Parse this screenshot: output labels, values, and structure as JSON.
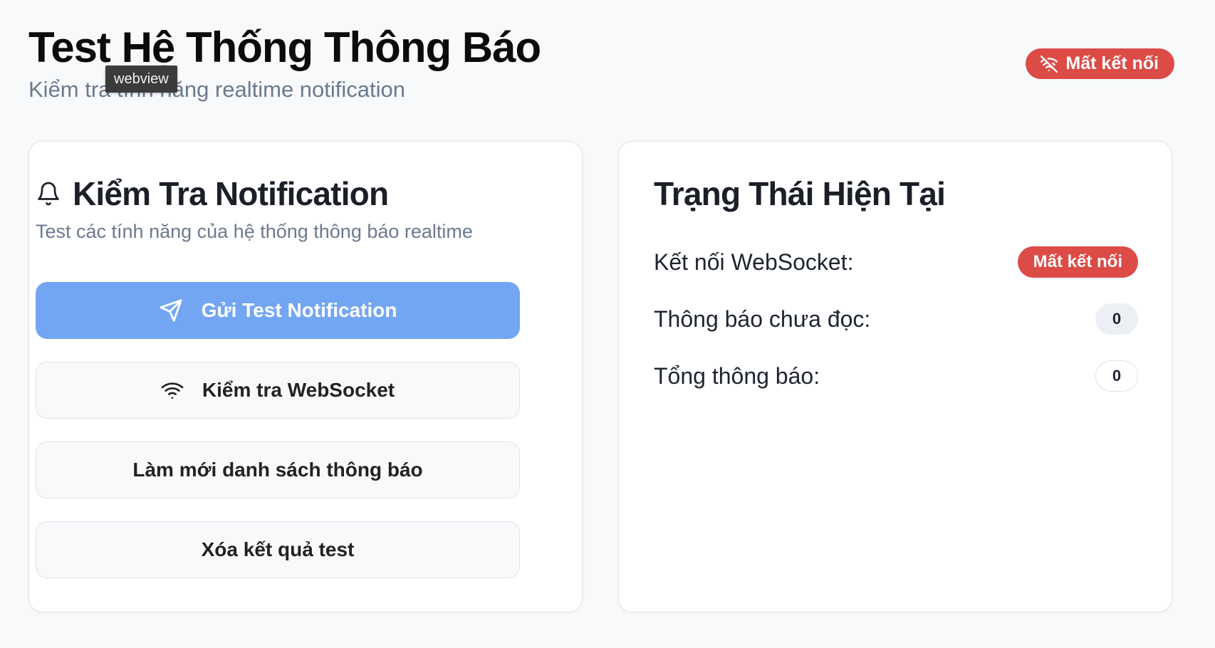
{
  "header": {
    "title": "Test Hệ Thống Thông Báo",
    "subtitle": "Kiểm tra tính năng realtime notification",
    "tooltip": "webview",
    "connection_badge": {
      "label": "Mất kết nối",
      "icon": "wifi-off-icon",
      "color": "#dc4b46"
    }
  },
  "test_card": {
    "icon": "bell-icon",
    "title": "Kiểm Tra Notification",
    "description": "Test các tính năng của hệ thống thông báo realtime",
    "buttons": {
      "send_test": {
        "label": "Gửi Test Notification",
        "icon": "send-icon",
        "color": "#73a6f2"
      },
      "check_ws": {
        "label": "Kiểm tra WebSocket",
        "icon": "wifi-icon"
      },
      "refresh": {
        "label": "Làm mới danh sách thông báo"
      },
      "clear": {
        "label": "Xóa kết quả test"
      }
    }
  },
  "status_card": {
    "title": "Trạng Thái Hiện Tại",
    "rows": {
      "websocket": {
        "label": "Kết nối WebSocket:",
        "value": "Mất kết nối",
        "color": "#dc4b46"
      },
      "unread": {
        "label": "Thông báo chưa đọc:",
        "value": "0"
      },
      "total": {
        "label": "Tổng thông báo:",
        "value": "0"
      }
    }
  }
}
